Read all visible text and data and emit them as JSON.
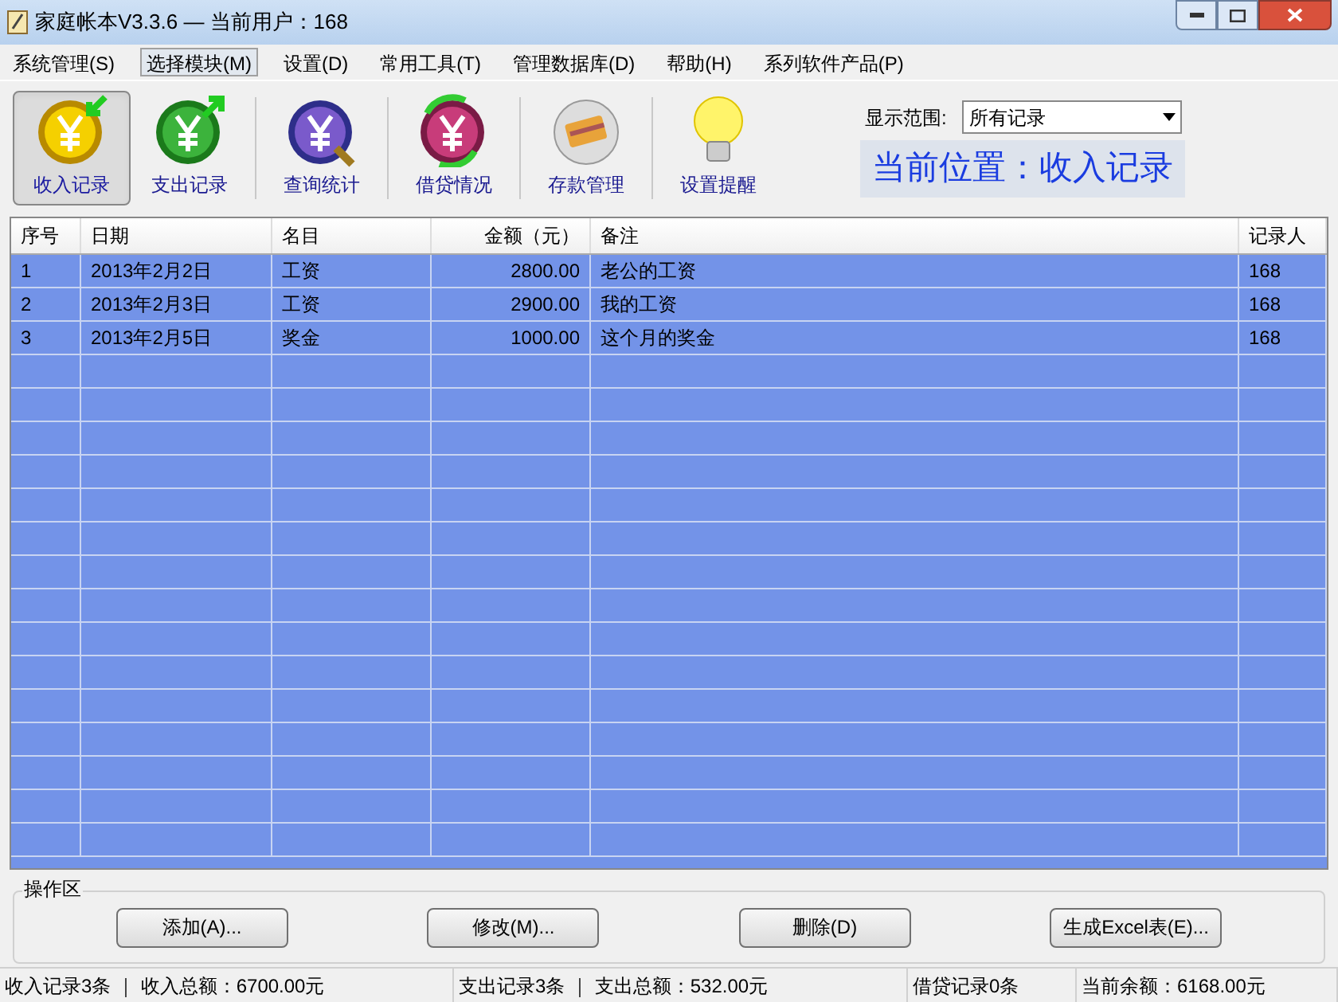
{
  "window": {
    "title": "家庭帐本V3.3.6 — 当前用户：168"
  },
  "menu": [
    {
      "label": "系统管理(S)",
      "selected": false
    },
    {
      "label": "选择模块(M)",
      "selected": true
    },
    {
      "label": "设置(D)",
      "selected": false
    },
    {
      "label": "常用工具(T)",
      "selected": false
    },
    {
      "label": "管理数据库(D)",
      "selected": false
    },
    {
      "label": "帮助(H)",
      "selected": false
    },
    {
      "label": "系列软件产品(P)",
      "selected": false
    }
  ],
  "toolbar": [
    {
      "label": "收入记录",
      "kind": "income",
      "selected": true
    },
    {
      "label": "支出记录",
      "kind": "expense",
      "selected": false
    },
    {
      "label": "查询统计",
      "kind": "query",
      "selected": false
    },
    {
      "label": "借贷情况",
      "kind": "loan",
      "selected": false
    },
    {
      "label": "存款管理",
      "kind": "deposit",
      "selected": false
    },
    {
      "label": "设置提醒",
      "kind": "reminder",
      "selected": false
    }
  ],
  "range": {
    "label": "显示范围:",
    "value": "所有记录"
  },
  "location": "当前位置：收入记录",
  "table": {
    "columns": [
      "序号",
      "日期",
      "名目",
      "金额（元）",
      "备注",
      "记录人"
    ],
    "rows": [
      [
        "1",
        "2013年2月2日",
        "工资",
        "2800.00",
        "老公的工资",
        "168"
      ],
      [
        "2",
        "2013年2月3日",
        "工资",
        "2900.00",
        "我的工资",
        "168"
      ],
      [
        "3",
        "2013年2月5日",
        "奖金",
        "1000.00",
        "这个月的奖金",
        "168"
      ]
    ]
  },
  "operations": {
    "title": "操作区",
    "buttons": [
      "添加(A)...",
      "修改(M)...",
      "删除(D)",
      "生成Excel表(E)..."
    ]
  },
  "status_bar": [
    "收入记录3条 ｜ 收入总额：6700.00元",
    "支出记录3条 ｜ 支出总额：532.00元",
    "借贷记录0条",
    "当前余额：6168.00元"
  ]
}
